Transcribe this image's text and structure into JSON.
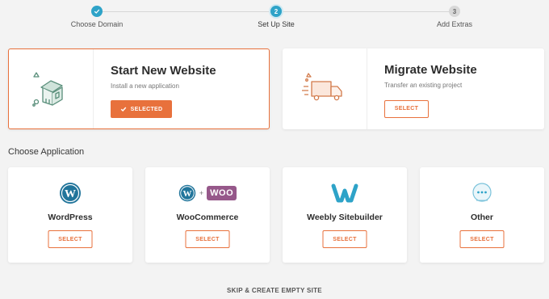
{
  "steps": [
    {
      "number": "1",
      "label": "Choose Domain",
      "state": "done"
    },
    {
      "number": "2",
      "label": "Set Up Site",
      "state": "active"
    },
    {
      "number": "3",
      "label": "Add Extras",
      "state": "todo"
    }
  ],
  "options": {
    "start": {
      "title": "Start New Website",
      "subtitle": "Install a new application",
      "button": "SELECTED"
    },
    "migrate": {
      "title": "Migrate Website",
      "subtitle": "Transfer an existing project",
      "button": "SELECT"
    }
  },
  "section_title": "Choose Application",
  "apps": [
    {
      "name": "WordPress",
      "button": "SELECT",
      "icon": "wordpress-icon"
    },
    {
      "name": "WooCommerce",
      "button": "SELECT",
      "icon": "woocommerce-icon",
      "badge": "WOO",
      "plus": "+"
    },
    {
      "name": "Weebly Sitebuilder",
      "button": "SELECT",
      "icon": "weebly-icon"
    },
    {
      "name": "Other",
      "button": "SELECT",
      "icon": "other-icon"
    }
  ],
  "skip_label": "SKIP & CREATE EMPTY SITE",
  "colors": {
    "accent": "#e8713c",
    "step": "#2ea3c8",
    "wordpress": "#21759b",
    "woo": "#96588a",
    "weebly": "#2ea3c8"
  }
}
